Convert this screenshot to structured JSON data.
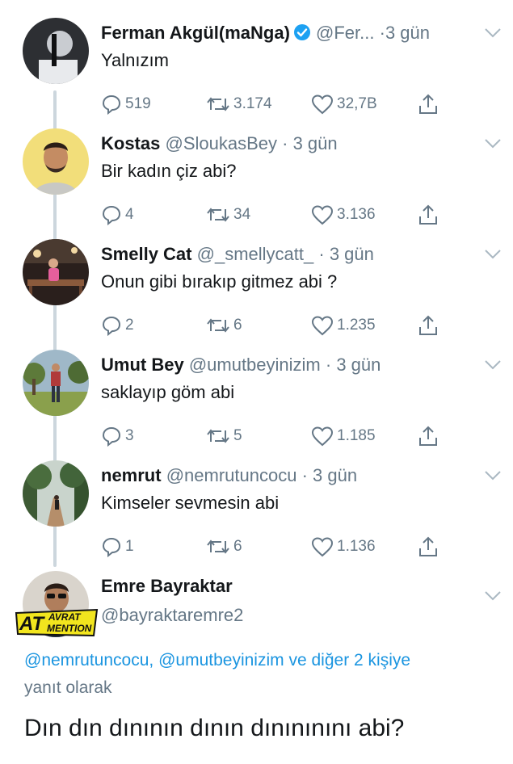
{
  "colors": {
    "text": "#14171a",
    "muted": "#657786",
    "link": "#1b95e0",
    "verified": "#1da1f2",
    "thread_line": "#ccd6dd"
  },
  "tweets": [
    {
      "name": "Ferman Akgül(maNga)",
      "verified": true,
      "handle": "@Fer...",
      "dot": "·",
      "time": "3 gün",
      "text": "Yalnızım",
      "replies": "519",
      "retweets": "3.174",
      "likes": "32,7B"
    },
    {
      "name": "Kostas",
      "verified": false,
      "handle": "@SloukasBey",
      "dot": "·",
      "time": "3 gün",
      "text": "Bir kadın çiz abi?",
      "replies": "4",
      "retweets": "34",
      "likes": "3.136"
    },
    {
      "name": "Smelly Cat",
      "verified": false,
      "handle": "@_smellycatt_",
      "dot": "·",
      "time": "3 gün",
      "text": "Onun gibi bırakıp gitmez abi ?",
      "replies": "2",
      "retweets": "6",
      "likes": "1.235"
    },
    {
      "name": "Umut Bey",
      "verified": false,
      "handle": "@umutbeyinizim",
      "dot": "·",
      "time": "3 gün",
      "text": "saklayıp göm abi",
      "replies": "3",
      "retweets": "5",
      "likes": "1.185"
    },
    {
      "name": "nemrut",
      "verified": false,
      "handle": "@nemrutuncocu",
      "dot": "·",
      "time": "3 gün",
      "text": "Kimseler sevmesin abi",
      "replies": "1",
      "retweets": "6",
      "likes": "1.136"
    }
  ],
  "main_tweet": {
    "name": "Emre Bayraktar",
    "handle": "@bayraktaremre2",
    "logo_text": [
      "AT",
      "AVRAT",
      "MENTION"
    ],
    "reply_mention_1": "@nemrutuncocu,",
    "reply_mention_2": "@umutbeyinizim",
    "reply_connector": "ve",
    "reply_others": "diğer 2 kişiye",
    "reply_suffix": "yanıt olarak",
    "text": "Dın dın dınının dının dınınınını abi?"
  }
}
